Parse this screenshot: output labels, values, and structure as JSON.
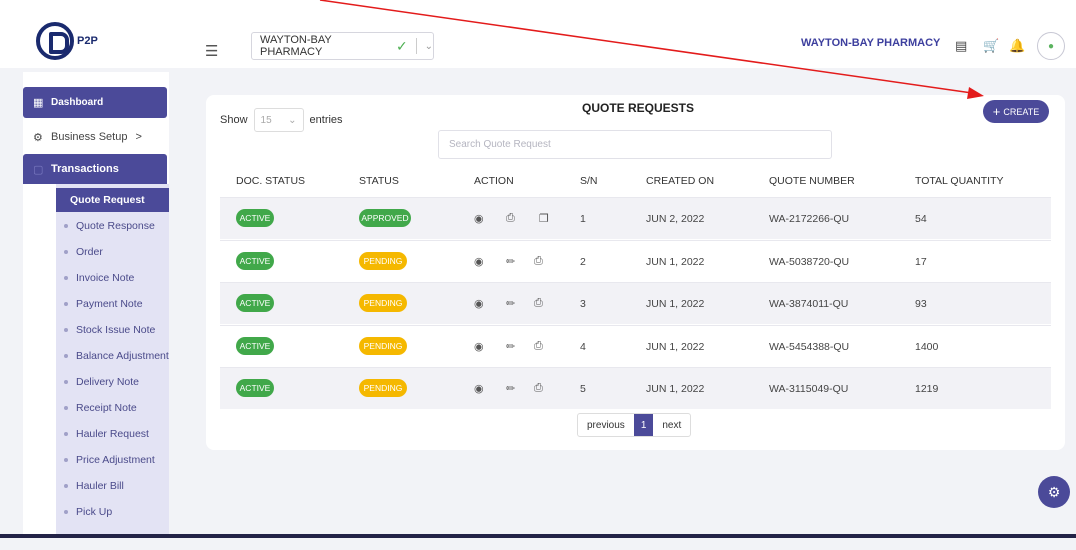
{
  "header": {
    "logo_text": "P2P",
    "pharmacy_select": "WAYTON-BAY PHARMACY",
    "org_name": "WAYTON-BAY PHARMACY",
    "icons": [
      "list-icon",
      "cart-icon",
      "bell-icon"
    ]
  },
  "sidebar": {
    "dashboard": "Dashboard",
    "business_setup": "Business Setup",
    "business_setup_arrow": ">",
    "transactions": "Transactions",
    "items": [
      "Quote Request",
      "Quote Response",
      "Order",
      "Invoice Note",
      "Payment Note",
      "Stock Issue Note",
      "Balance Adjustment",
      "Delivery Note",
      "Receipt Note",
      "Hauler Request",
      "Price Adjustment",
      "Hauler Bill",
      "Pick Up"
    ]
  },
  "main": {
    "show_label": "Show",
    "entries_value": "15",
    "entries_label": "entries",
    "title": "QUOTE REQUESTS",
    "create_label": "CREATE",
    "search_placeholder": "Search Quote Request",
    "columns": [
      "DOC. STATUS",
      "STATUS",
      "ACTION",
      "S/N",
      "CREATED ON",
      "QUOTE NUMBER",
      "TOTAL QUANTITY"
    ],
    "rows": [
      {
        "doc_status": "ACTIVE",
        "status": "APPROVED",
        "sn": "1",
        "created_on": "JUN 2, 2022",
        "quote_number": "WA-2172266-QU",
        "total_quantity": "54"
      },
      {
        "doc_status": "ACTIVE",
        "status": "PENDING",
        "sn": "2",
        "created_on": "JUN 1, 2022",
        "quote_number": "WA-5038720-QU",
        "total_quantity": "17"
      },
      {
        "doc_status": "ACTIVE",
        "status": "PENDING",
        "sn": "3",
        "created_on": "JUN 1, 2022",
        "quote_number": "WA-3874011-QU",
        "total_quantity": "93"
      },
      {
        "doc_status": "ACTIVE",
        "status": "PENDING",
        "sn": "4",
        "created_on": "JUN 1, 2022",
        "quote_number": "WA-5454388-QU",
        "total_quantity": "1400"
      },
      {
        "doc_status": "ACTIVE",
        "status": "PENDING",
        "sn": "5",
        "created_on": "JUN 1, 2022",
        "quote_number": "WA-3115049-QU",
        "total_quantity": "1219"
      }
    ],
    "pagination": {
      "previous": "previous",
      "current": "1",
      "next": "next"
    }
  },
  "colors": {
    "brand": "#4b4a99",
    "active": "#41a84a",
    "pending": "#f5b800",
    "annotation": "#e31b1b"
  }
}
